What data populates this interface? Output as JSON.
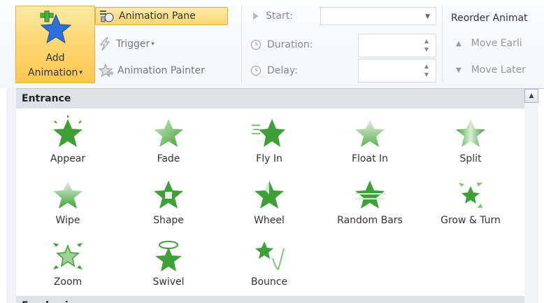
{
  "ribbon": {
    "add_animation": {
      "line1": "Add",
      "line2": "Animation",
      "caret": "▾"
    },
    "animation_pane": "Animation Pane",
    "trigger": "Trigger",
    "trigger_caret": "▾",
    "animation_painter": "Animation Painter",
    "start_label": "Start:",
    "start_value": "",
    "duration_label": "Duration:",
    "duration_value": "",
    "delay_label": "Delay:",
    "delay_value": "",
    "reorder_title": "Reorder Animat",
    "move_earlier": "Move Earli",
    "move_later": "Move Later"
  },
  "gallery": {
    "entrance_header": "Entrance",
    "emphasis_header": "Emphasis",
    "items": [
      {
        "label": "Appear"
      },
      {
        "label": "Fade"
      },
      {
        "label": "Fly In"
      },
      {
        "label": "Float In"
      },
      {
        "label": "Split"
      },
      {
        "label": "Wipe"
      },
      {
        "label": "Shape"
      },
      {
        "label": "Wheel"
      },
      {
        "label": "Random Bars"
      },
      {
        "label": "Grow & Turn"
      },
      {
        "label": "Zoom"
      },
      {
        "label": "Swivel"
      },
      {
        "label": "Bounce"
      }
    ]
  },
  "colors": {
    "accent_star": "#3fa03a",
    "highlight_button": "#fcd774",
    "blue_star": "#2f6fd8"
  }
}
